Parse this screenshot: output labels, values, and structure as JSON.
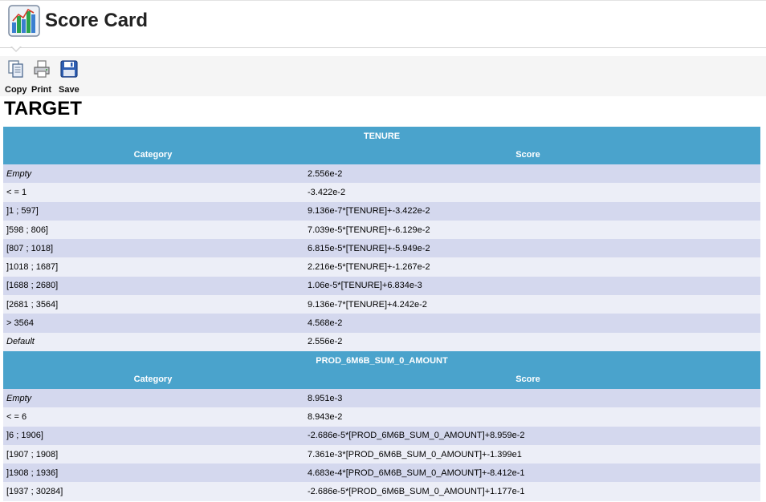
{
  "header": {
    "title": "Score Card",
    "logo_icon": "bar-chart-icon"
  },
  "toolbar": {
    "copy_label": "Copy",
    "print_label": "Print",
    "save_label": "Save"
  },
  "target": {
    "title": "TARGET"
  },
  "colors": {
    "section_header": "#4aa3cc",
    "row_odd": "#d4d8ee",
    "row_even": "#eceef7"
  },
  "sections": [
    {
      "title": "TENURE",
      "col_category": "Category",
      "col_score": "Score",
      "rows": [
        {
          "category": "Empty",
          "score": "2.556e-2",
          "italic": true
        },
        {
          "category": "< = 1",
          "score": "-3.422e-2"
        },
        {
          "category": "]1 ; 597]",
          "score": "9.136e-7*[TENURE]+-3.422e-2"
        },
        {
          "category": "]598 ; 806]",
          "score": "7.039e-5*[TENURE]+-6.129e-2"
        },
        {
          "category": "[807 ; 1018]",
          "score": "6.815e-5*[TENURE]+-5.949e-2"
        },
        {
          "category": "]1018 ; 1687]",
          "score": "2.216e-5*[TENURE]+-1.267e-2"
        },
        {
          "category": "[1688 ; 2680]",
          "score": "1.06e-5*[TENURE]+6.834e-3"
        },
        {
          "category": "[2681 ; 3564]",
          "score": "9.136e-7*[TENURE]+4.242e-2"
        },
        {
          "category": "> 3564",
          "score": "4.568e-2"
        },
        {
          "category": "Default",
          "score": "2.556e-2",
          "italic": true
        }
      ]
    },
    {
      "title": "PROD_6M6B_SUM_0_AMOUNT",
      "col_category": "Category",
      "col_score": "Score",
      "rows": [
        {
          "category": "Empty",
          "score": "8.951e-3",
          "italic": true
        },
        {
          "category": "< = 6",
          "score": "8.943e-2"
        },
        {
          "category": "]6 ; 1906]",
          "score": "-2.686e-5*[PROD_6M6B_SUM_0_AMOUNT]+8.959e-2"
        },
        {
          "category": "[1907 ; 1908]",
          "score": "7.361e-3*[PROD_6M6B_SUM_0_AMOUNT]+-1.399e1"
        },
        {
          "category": "]1908 ; 1936]",
          "score": "4.683e-4*[PROD_6M6B_SUM_0_AMOUNT]+-8.412e-1"
        },
        {
          "category": "[1937 ; 30284]",
          "score": "-2.686e-5*[PROD_6M6B_SUM_0_AMOUNT]+1.177e-1"
        }
      ]
    }
  ]
}
